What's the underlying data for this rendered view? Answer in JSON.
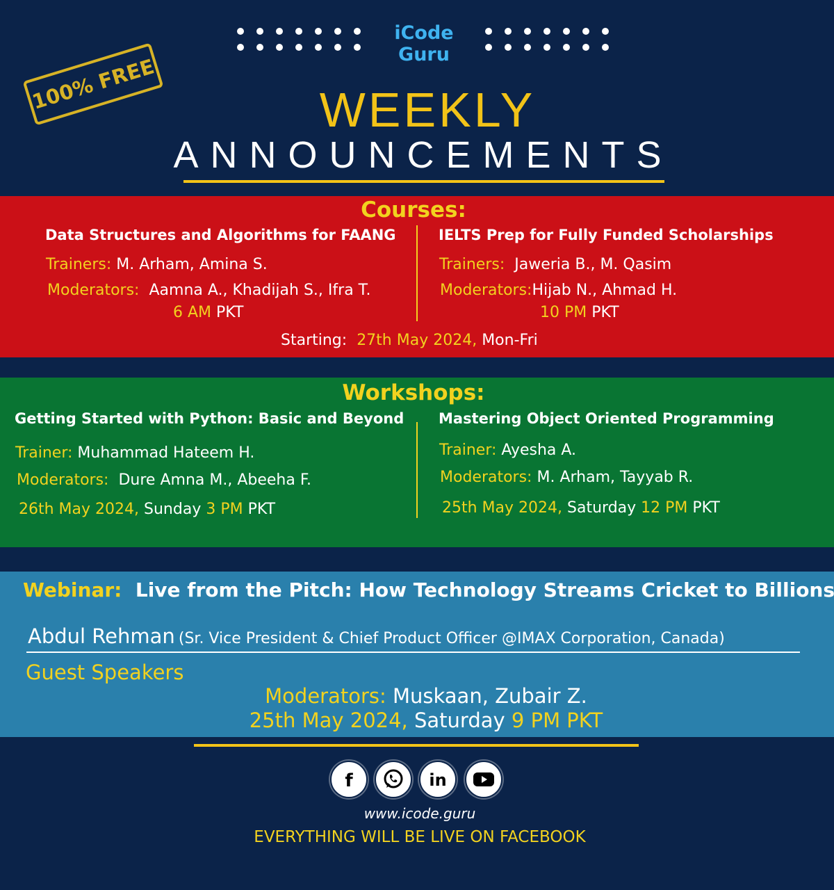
{
  "brand": {
    "line1": "iCode",
    "line2": "Guru"
  },
  "stamp": "100% FREE",
  "header": {
    "title1": "WEEKLY",
    "title2": "ANNOUNCEMENTS"
  },
  "courses": {
    "heading": "Courses:",
    "left": {
      "title": "Data Structures and Algorithms for FAANG",
      "trainers_label": "Trainers:",
      "trainers": "M. Arham, Amina S.",
      "moderators_label": "Moderators:",
      "moderators": "Aamna A., Khadijah S., Ifra T.",
      "time": "6 AM",
      "tz": "PKT"
    },
    "right": {
      "title": "IELTS Prep for Fully Funded Scholarships",
      "trainers_label": "Trainers:",
      "trainers": "Jaweria B., M. Qasim",
      "moderators_label": "Moderators:",
      "moderators": "Hijab N., Ahmad H.",
      "time": "10 PM",
      "tz": "PKT"
    },
    "starting_label": "Starting:",
    "starting_date": "27th May 2024,",
    "starting_days": "Mon-Fri"
  },
  "workshops": {
    "heading": "Workshops:",
    "left": {
      "title": "Getting Started with Python: Basic and Beyond",
      "trainer_label": "Trainer:",
      "trainer": "Muhammad Hateem H.",
      "moderators_label": "Moderators:",
      "moderators": "Dure Amna M., Abeeha F.",
      "date": "26th May 2024,",
      "day": "Sunday",
      "time": "3 PM",
      "tz": "PKT"
    },
    "right": {
      "title": "Mastering Object Oriented Programming",
      "trainer_label": "Trainer:",
      "trainer": "Ayesha A.",
      "moderators_label": "Moderators:",
      "moderators": "M. Arham, Tayyab R.",
      "date": "25th May 2024,",
      "day": "Saturday",
      "time": "12 PM",
      "tz": "PKT"
    }
  },
  "webinar": {
    "label": "Webinar:",
    "title": "Live from the Pitch: How Technology Streams Cricket to Billions",
    "speaker_name": "Abdul Rehman",
    "speaker_role": "(Sr. Vice President & Chief Product Officer @IMAX Corporation, Canada)",
    "guest_label": "Guest Speakers",
    "moderators_label": "Moderators:",
    "moderators": "Muskaan, Zubair Z.",
    "date": "25th May 2024,",
    "day": "Saturday",
    "time": "9 PM PKT"
  },
  "footer": {
    "website": "www.icode.guru",
    "live_note": "EVERYTHING WILL BE LIVE ON FACEBOOK",
    "social_icons": [
      "facebook-icon",
      "whatsapp-icon",
      "linkedin-icon",
      "youtube-icon"
    ]
  },
  "colors": {
    "navy": "#0b2349",
    "gold": "#f2d21f",
    "red": "#cb1017",
    "green": "#097533",
    "blue": "#2a80ac",
    "brand_blue": "#3fb3f0"
  }
}
